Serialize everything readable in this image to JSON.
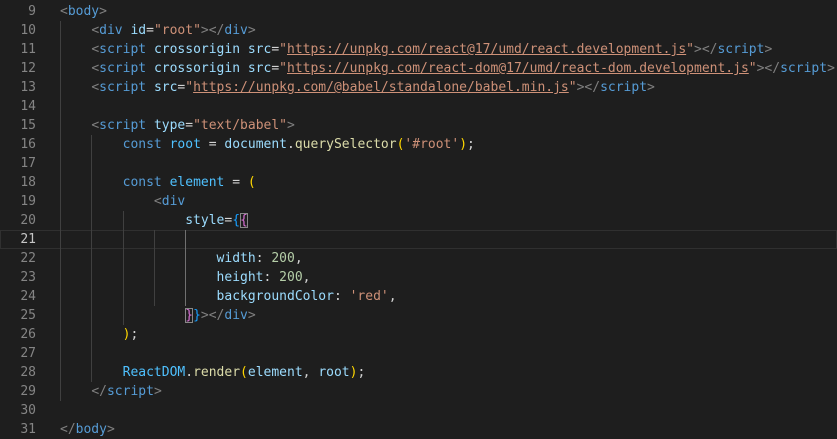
{
  "colors": {
    "background": "#1e1e1e",
    "line_number": "#858585",
    "tag": "#569cd6",
    "bracket_tag": "#808080",
    "attr": "#9cdcfe",
    "string": "#ce9178",
    "keyword": "#569cd6",
    "variable": "#4fc1ff",
    "function": "#dcdcaa",
    "number": "#b5cea8",
    "paren": "#ffd700",
    "brace_inner": "#da70d6",
    "brace_outer": "#179fff",
    "text": "#d4d4d4"
  },
  "active_line": 21,
  "lines": [
    {
      "num": "9",
      "indent": 0,
      "tokens": [
        [
          "<",
          "bracket_tag"
        ],
        [
          "body",
          "tag"
        ],
        [
          ">",
          "bracket_tag"
        ]
      ]
    },
    {
      "num": "10",
      "indent": 1,
      "tokens": [
        [
          "<",
          "bracket_tag"
        ],
        [
          "div",
          "tag"
        ],
        [
          " ",
          "text"
        ],
        [
          "id",
          "attr"
        ],
        [
          "=",
          "text"
        ],
        [
          "\"root\"",
          "string"
        ],
        [
          "></",
          "bracket_tag"
        ],
        [
          "div",
          "tag"
        ],
        [
          ">",
          "bracket_tag"
        ]
      ]
    },
    {
      "num": "11",
      "indent": 1,
      "tokens": [
        [
          "<",
          "bracket_tag"
        ],
        [
          "script",
          "tag"
        ],
        [
          " ",
          "text"
        ],
        [
          "crossorigin",
          "attr"
        ],
        [
          " ",
          "text"
        ],
        [
          "src",
          "attr"
        ],
        [
          "=",
          "text"
        ],
        [
          "\"",
          "string"
        ],
        [
          "https://unpkg.com/react@17/umd/react.development.js",
          "string_u"
        ],
        [
          "\"",
          "string"
        ],
        [
          "></",
          "bracket_tag"
        ],
        [
          "script",
          "tag"
        ],
        [
          ">",
          "bracket_tag"
        ]
      ]
    },
    {
      "num": "12",
      "indent": 1,
      "tokens": [
        [
          "<",
          "bracket_tag"
        ],
        [
          "script",
          "tag"
        ],
        [
          " ",
          "text"
        ],
        [
          "crossorigin",
          "attr"
        ],
        [
          " ",
          "text"
        ],
        [
          "src",
          "attr"
        ],
        [
          "=",
          "text"
        ],
        [
          "\"",
          "string"
        ],
        [
          "https://unpkg.com/react-dom@17/umd/react-dom.development.js",
          "string_u"
        ],
        [
          "\"",
          "string"
        ],
        [
          "></",
          "bracket_tag"
        ],
        [
          "script",
          "tag"
        ],
        [
          ">",
          "bracket_tag"
        ]
      ]
    },
    {
      "num": "13",
      "indent": 1,
      "tokens": [
        [
          "<",
          "bracket_tag"
        ],
        [
          "script",
          "tag"
        ],
        [
          " ",
          "text"
        ],
        [
          "src",
          "attr"
        ],
        [
          "=",
          "text"
        ],
        [
          "\"",
          "string"
        ],
        [
          "https://unpkg.com/@babel/standalone/babel.min.js",
          "string_u"
        ],
        [
          "\"",
          "string"
        ],
        [
          "></",
          "bracket_tag"
        ],
        [
          "script",
          "tag"
        ],
        [
          ">",
          "bracket_tag"
        ]
      ]
    },
    {
      "num": "14",
      "indent": 0,
      "tokens": []
    },
    {
      "num": "15",
      "indent": 1,
      "tokens": [
        [
          "<",
          "bracket_tag"
        ],
        [
          "script",
          "tag"
        ],
        [
          " ",
          "text"
        ],
        [
          "type",
          "attr"
        ],
        [
          "=",
          "text"
        ],
        [
          "\"text/babel\"",
          "string"
        ],
        [
          ">",
          "bracket_tag"
        ]
      ]
    },
    {
      "num": "16",
      "indent": 2,
      "tokens": [
        [
          "const",
          "keyword"
        ],
        [
          " ",
          "text"
        ],
        [
          "root",
          "variable"
        ],
        [
          " = ",
          "text"
        ],
        [
          "document",
          "attr"
        ],
        [
          ".",
          "text"
        ],
        [
          "querySelector",
          "function"
        ],
        [
          "(",
          "paren"
        ],
        [
          "'#root'",
          "string"
        ],
        [
          ")",
          "paren"
        ],
        [
          ";",
          "text"
        ]
      ]
    },
    {
      "num": "17",
      "indent": 0,
      "tokens": []
    },
    {
      "num": "18",
      "indent": 2,
      "tokens": [
        [
          "const",
          "keyword"
        ],
        [
          " ",
          "text"
        ],
        [
          "element",
          "variable"
        ],
        [
          " = ",
          "text"
        ],
        [
          "(",
          "paren"
        ]
      ]
    },
    {
      "num": "19",
      "indent": 3,
      "tokens": [
        [
          "<",
          "bracket_tag"
        ],
        [
          "div",
          "tag"
        ]
      ]
    },
    {
      "num": "20",
      "indent": 4,
      "tokens": [
        [
          "style",
          "attr"
        ],
        [
          "=",
          "text"
        ],
        [
          "{",
          "brace_outer"
        ],
        [
          "{",
          "brace_inner_sel"
        ]
      ]
    },
    {
      "num": "21",
      "indent": 0,
      "tokens": []
    },
    {
      "num": "22",
      "indent": 5,
      "tokens": [
        [
          "width",
          "attr"
        ],
        [
          ": ",
          "text"
        ],
        [
          "200",
          "number"
        ],
        [
          ",",
          "text"
        ]
      ]
    },
    {
      "num": "23",
      "indent": 5,
      "tokens": [
        [
          "height",
          "attr"
        ],
        [
          ": ",
          "text"
        ],
        [
          "200",
          "number"
        ],
        [
          ",",
          "text"
        ]
      ]
    },
    {
      "num": "24",
      "indent": 5,
      "tokens": [
        [
          "backgroundColor",
          "attr"
        ],
        [
          ": ",
          "text"
        ],
        [
          "'red'",
          "string"
        ],
        [
          ",",
          "text"
        ]
      ]
    },
    {
      "num": "25",
      "indent": 4,
      "tokens": [
        [
          "}",
          "brace_inner_sel"
        ],
        [
          "}",
          "brace_outer"
        ],
        [
          "></",
          "bracket_tag"
        ],
        [
          "div",
          "tag"
        ],
        [
          ">",
          "bracket_tag"
        ]
      ]
    },
    {
      "num": "26",
      "indent": 2,
      "tokens": [
        [
          ")",
          "paren"
        ],
        [
          ";",
          "text"
        ]
      ]
    },
    {
      "num": "27",
      "indent": 0,
      "tokens": []
    },
    {
      "num": "28",
      "indent": 2,
      "tokens": [
        [
          "ReactDOM",
          "variable"
        ],
        [
          ".",
          "text"
        ],
        [
          "render",
          "function"
        ],
        [
          "(",
          "paren"
        ],
        [
          "element",
          "attr"
        ],
        [
          ", ",
          "text"
        ],
        [
          "root",
          "attr"
        ],
        [
          ")",
          "paren"
        ],
        [
          ";",
          "text"
        ]
      ]
    },
    {
      "num": "29",
      "indent": 1,
      "tokens": [
        [
          "</",
          "bracket_tag"
        ],
        [
          "script",
          "tag"
        ],
        [
          ">",
          "bracket_tag"
        ]
      ]
    },
    {
      "num": "30",
      "indent": 0,
      "tokens": []
    },
    {
      "num": "31",
      "indent": 0,
      "tokens": [
        [
          "</",
          "bracket_tag"
        ],
        [
          "body",
          "tag"
        ],
        [
          ">",
          "bracket_tag"
        ]
      ]
    }
  ]
}
